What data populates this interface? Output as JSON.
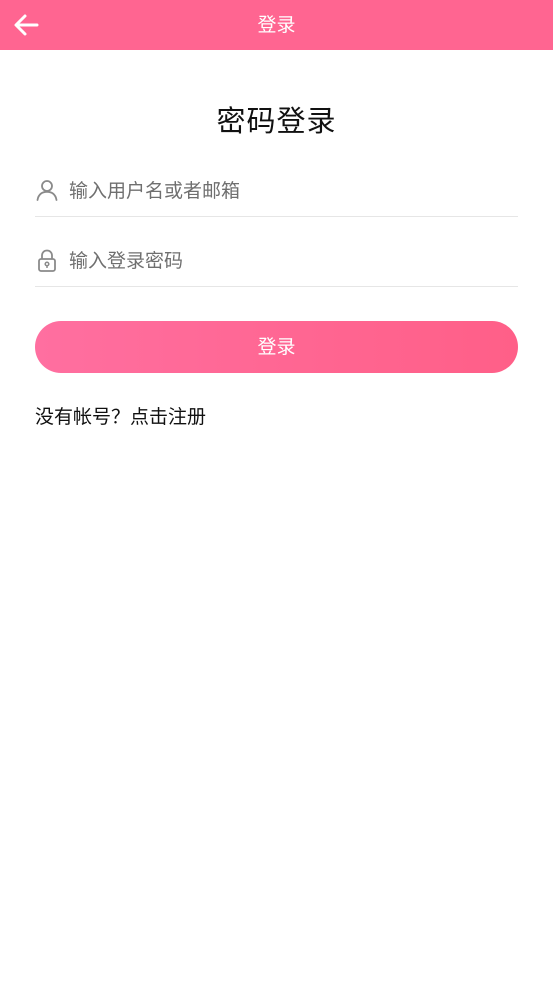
{
  "header": {
    "title": "登录",
    "back_icon": "arrow-left-icon"
  },
  "main": {
    "heading": "密码登录",
    "username": {
      "icon": "user-icon",
      "placeholder": "输入用户名或者邮箱",
      "value": ""
    },
    "password": {
      "icon": "lock-icon",
      "placeholder": "输入登录密码",
      "value": ""
    },
    "login_button_label": "登录",
    "register_link_label": "没有帐号？点击注册"
  },
  "colors": {
    "accent": "#ff6591",
    "background": "#ffffff"
  }
}
